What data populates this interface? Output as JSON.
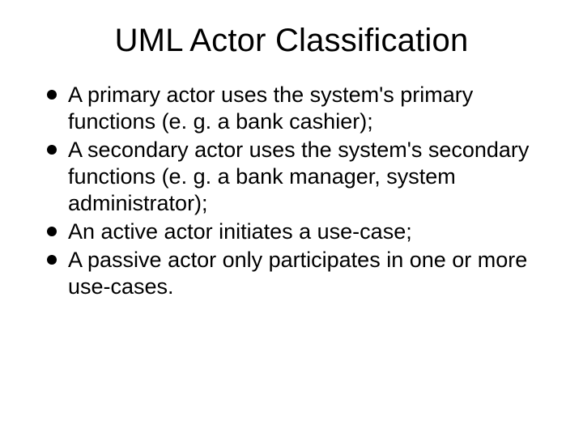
{
  "slide": {
    "title": "UML Actor Classification",
    "bullets": [
      "A primary actor uses the system's primary functions (e. g. a bank cashier);",
      "A secondary actor uses the system's secondary functions (e. g. a bank manager, system administrator);",
      "An active actor initiates a use-case;",
      "A passive actor only participates in one or more use-cases."
    ]
  }
}
